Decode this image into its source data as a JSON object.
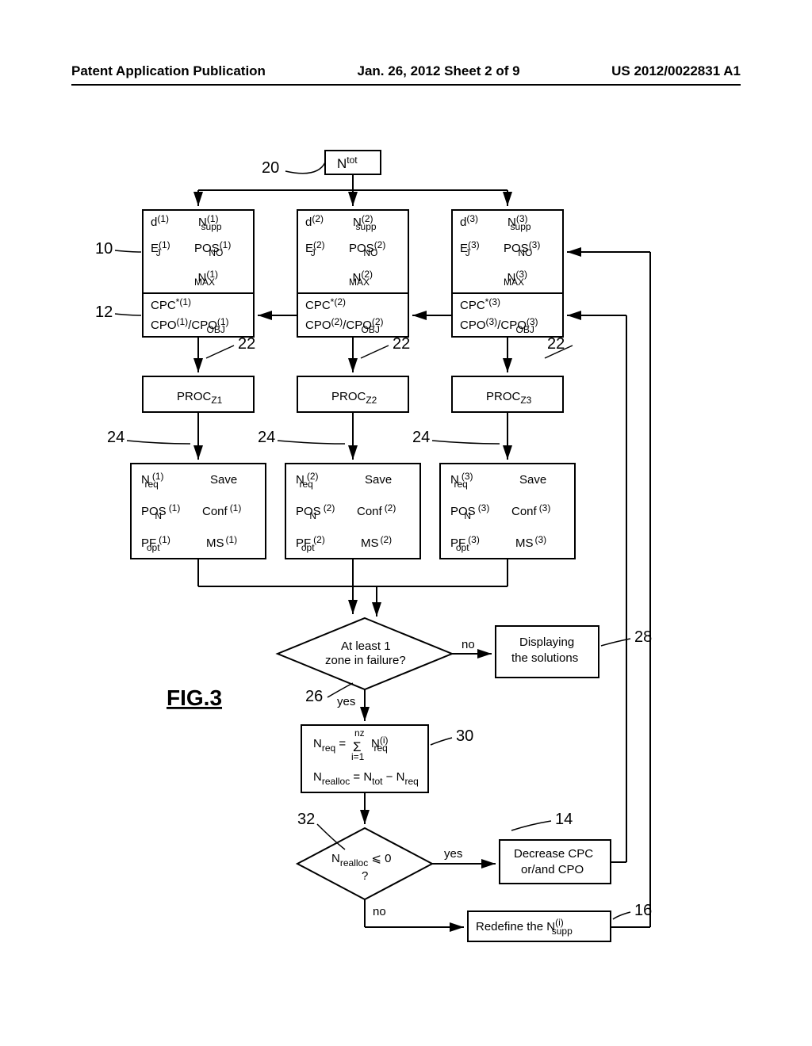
{
  "header": {
    "left": "Patent Application Publication",
    "center": "Jan. 26, 2012  Sheet 2 of 9",
    "right": "US 2012/0022831 A1"
  },
  "figure_label": "FIG.3",
  "refs": {
    "r10": "10",
    "r12": "12",
    "r14": "14",
    "r16": "16",
    "r20": "20",
    "r22a": "22",
    "r22b": "22",
    "r22c": "22",
    "r24a": "24",
    "r24b": "24",
    "r24c": "24",
    "r26": "26",
    "r28": "28",
    "r30": "30",
    "r32": "32"
  },
  "top_box": {
    "label": "N",
    "sup": "tot"
  },
  "input_boxes": [
    {
      "d": "d",
      "d_sup": "(1)",
      "nsupp": "N",
      "nsupp_sub": "supp",
      "nsupp_sup": "(1)",
      "e": "E",
      "e_sub": "J",
      "e_sup": "(1)",
      "pos": "POS",
      "pos_sub": "NO",
      "pos_sup": "(1)",
      "nmax": "N",
      "nmax_sub": "MAX",
      "nmax_sup": "(1)"
    },
    {
      "d": "d",
      "d_sup": "(2)",
      "nsupp": "N",
      "nsupp_sub": "supp",
      "nsupp_sup": "(2)",
      "e": "E",
      "e_sub": "J",
      "e_sup": "(2)",
      "pos": "POS",
      "pos_sub": "NO",
      "pos_sup": "(2)",
      "nmax": "N",
      "nmax_sub": "MAX",
      "nmax_sup": "(2)"
    },
    {
      "d": "d",
      "d_sup": "(3)",
      "nsupp": "N",
      "nsupp_sub": "supp",
      "nsupp_sup": "(3)",
      "e": "E",
      "e_sub": "J",
      "e_sup": "(3)",
      "pos": "POS",
      "pos_sub": "NO",
      "pos_sup": "(3)",
      "nmax": "N",
      "nmax_sub": "MAX",
      "nmax_sup": "(3)"
    }
  ],
  "cpc_boxes": [
    {
      "cpc": "CPC",
      "cpc_sup": "*(1)",
      "cpo": "CPO",
      "cpo_sup": "(1)",
      "slash": "/",
      "cpoobj": "CPO",
      "cpoobj_sub": "OBJ",
      "cpoobj_sup": "(1)"
    },
    {
      "cpc": "CPC",
      "cpc_sup": "*(2)",
      "cpo": "CPO",
      "cpo_sup": "(2)",
      "slash": "/",
      "cpoobj": "CPO",
      "cpoobj_sub": "OBJ",
      "cpoobj_sup": "(2)"
    },
    {
      "cpc": "CPC",
      "cpc_sup": "*(3)",
      "cpo": "CPO",
      "cpo_sup": "(3)",
      "slash": "/",
      "cpoobj": "CPO",
      "cpoobj_sub": "OBJ",
      "cpoobj_sup": "(3)"
    }
  ],
  "proc_boxes": [
    {
      "label": "PROC",
      "sub": "Z1"
    },
    {
      "label": "PROC",
      "sub": "Z2"
    },
    {
      "label": "PROC",
      "sub": "Z3"
    }
  ],
  "output_boxes": [
    {
      "nreq": "N",
      "nreq_sub": "req",
      "nreq_sup": "(1)",
      "save": "Save",
      "pos": "POS",
      "pos_sub": "N",
      "pos_sup": "(1)",
      "conf": "Conf",
      "conf_sup": "(1)",
      "pf": "PF",
      "pf_sub": "opt",
      "pf_sup": "(1)",
      "ms": "MS",
      "ms_sup": "(1)"
    },
    {
      "nreq": "N",
      "nreq_sub": "req",
      "nreq_sup": "(2)",
      "save": "Save",
      "pos": "POS",
      "pos_sub": "N",
      "pos_sup": "(2)",
      "conf": "Conf",
      "conf_sup": "(2)",
      "pf": "PF",
      "pf_sub": "opt",
      "pf_sup": "(2)",
      "ms": "MS",
      "ms_sup": "(2)"
    },
    {
      "nreq": "N",
      "nreq_sub": "req",
      "nreq_sup": "(3)",
      "save": "Save",
      "pos": "POS",
      "pos_sub": "N",
      "pos_sup": "(3)",
      "conf": "Conf",
      "conf_sup": "(3)",
      "pf": "PF",
      "pf_sub": "opt",
      "pf_sup": "(3)",
      "ms": "MS",
      "ms_sup": "(3)"
    }
  ],
  "diamond1": {
    "line1": "At least 1",
    "line2": "zone in failure?"
  },
  "display_box": {
    "line1": "Displaying",
    "line2": "the solutions"
  },
  "sum_box": {
    "line1_left": "N",
    "line1_left_sub": "req",
    "line1_eq": "=",
    "line1_sigma": "Σ",
    "line1_sigma_top": "nz",
    "line1_sigma_bot": "i=1",
    "line1_right": "N",
    "line1_right_sub": "req",
    "line1_right_sup": "(i)",
    "line2_left": "N",
    "line2_left_sub": "realloc",
    "line2_eq": "=",
    "line2_ntot": "N",
    "line2_ntot_sub": "tot",
    "line2_minus": "−",
    "line2_nreq": "N",
    "line2_nreq_sub": "req"
  },
  "diamond2": {
    "line1": "N",
    "line1_sub": "realloc",
    "line1_op": "⩽ 0",
    "line2": "?"
  },
  "decrease_box": {
    "line1": "Decrease CPC",
    "line2": "or/and CPO"
  },
  "redefine_box": {
    "text": "Redefine the N",
    "sub": "supp",
    "sup": "(i)"
  },
  "labels": {
    "yes": "yes",
    "no": "no"
  }
}
